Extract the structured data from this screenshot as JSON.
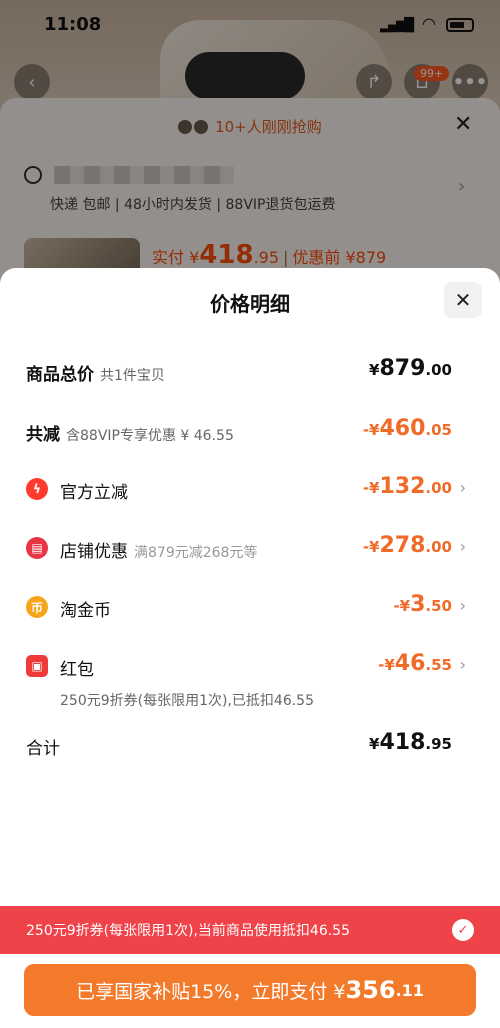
{
  "status_bar": {
    "time": "11:08",
    "cart_badge": "99+"
  },
  "background": {
    "buyers_text": "10+人刚刚抢购",
    "delivery_info": "快递 包邮 | 48小时内发货 | 88VIP退货包运费",
    "pay_label": "实付 ¥",
    "pay_int": "418",
    "pay_dec": ".95",
    "before_discount": "优惠前 ¥879"
  },
  "sheet": {
    "title": "价格明细",
    "total": {
      "label": "商品总价",
      "note": "共1件宝贝",
      "currency": "¥",
      "int": "879",
      "dec": ".00"
    },
    "reduce": {
      "label": "共减",
      "note": "含88VIP专享优惠 ¥ 46.55",
      "prefix": "-¥",
      "int": "460",
      "dec": ".05"
    },
    "items": [
      {
        "label": "官方立减",
        "note": "",
        "prefix": "-¥",
        "int": "132",
        "dec": ".00",
        "icon": "lightning-icon",
        "color": "#ff3b30"
      },
      {
        "label": "店铺优惠",
        "note": "满879元减268元等",
        "prefix": "-¥",
        "int": "278",
        "dec": ".00",
        "icon": "shop-icon",
        "color": "#e83544"
      },
      {
        "label": "淘金币",
        "note": "",
        "prefix": "-¥",
        "int": "3",
        "dec": ".50",
        "icon": "coin-icon",
        "color": "#f6a51b"
      },
      {
        "label": "红包",
        "note": "",
        "prefix": "-¥",
        "int": "46",
        "dec": ".55",
        "icon": "red-packet-icon",
        "color": "#ef3a3a"
      }
    ],
    "redpacket_desc": "250元9折券(每张限用1次),已抵扣46.55",
    "sum": {
      "label": "合计",
      "currency": "¥",
      "int": "418",
      "dec": ".95"
    }
  },
  "coupon_bar": {
    "text": "250元9折券(每张限用1次),当前商品使用抵扣46.55"
  },
  "pay_button": {
    "text": "已享国家补贴15%，立即支付 ¥",
    "int": "356",
    "dec": ".11"
  },
  "colors": {
    "accent_orange": "#f47a2b",
    "coupon_red": "#ef4249",
    "discount_orange": "#f06a28"
  }
}
